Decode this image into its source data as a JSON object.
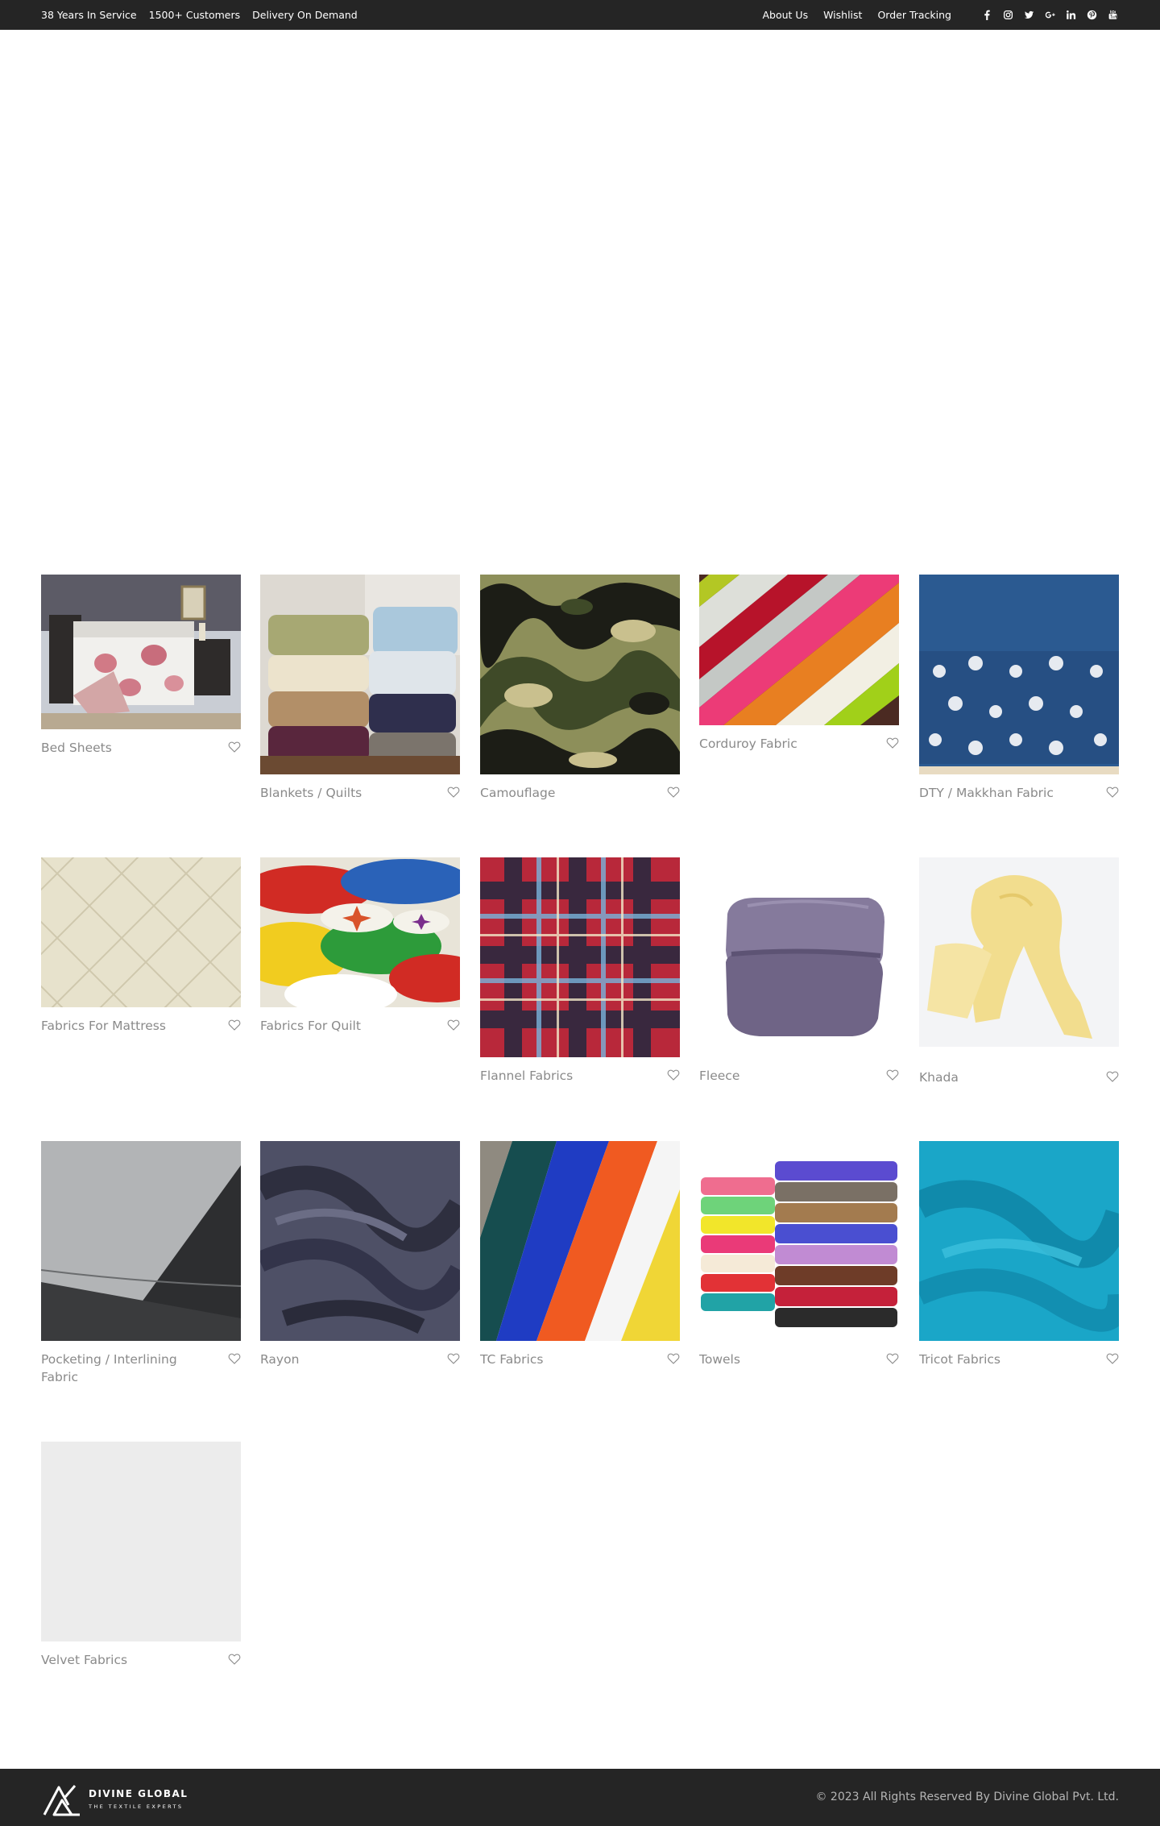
{
  "topbar": {
    "left_items": [
      "38 Years In Service",
      "1500+ Customers",
      "Delivery On Demand"
    ],
    "links": [
      "About Us",
      "Wishlist",
      "Order Tracking"
    ],
    "social_icons": [
      "facebook-icon",
      "instagram-icon",
      "twitter-icon",
      "google-plus-icon",
      "linkedin-icon",
      "pinterest-icon",
      "youtube-icon"
    ]
  },
  "products": [
    {
      "name": "Bed Sheets",
      "image": "bedroom-sheet-image"
    },
    {
      "name": "Blankets / Quilts",
      "image": "folded-blankets-image"
    },
    {
      "name": "Camouflage",
      "image": "camouflage-image"
    },
    {
      "name": "Corduroy Fabric",
      "image": "corduroy-image"
    },
    {
      "name": "DTY / Makkhan Fabric",
      "image": "embroidered-denim-image"
    },
    {
      "name": "Fabrics For Mattress",
      "image": "quilted-mattress-image"
    },
    {
      "name": "Fabrics For Quilt",
      "image": "patchwork-quilt-image"
    },
    {
      "name": "Flannel Fabrics",
      "image": "plaid-flannel-image"
    },
    {
      "name": "Fleece",
      "image": "folded-fleece-image"
    },
    {
      "name": "Khada",
      "image": "yellow-scarf-image"
    },
    {
      "name": "Pocketing / Interlining Fabric",
      "image": "interlining-image"
    },
    {
      "name": "Rayon",
      "image": "rayon-image"
    },
    {
      "name": "TC Fabrics",
      "image": "colored-fabric-rolls-image"
    },
    {
      "name": "Towels",
      "image": "towel-stacks-image"
    },
    {
      "name": "Tricot Fabrics",
      "image": "teal-tricot-image"
    },
    {
      "name": "Velvet Fabrics",
      "image": "placeholder-image"
    }
  ],
  "colors": {
    "topbar_bg": "#252525",
    "caption": "#8a8a8a",
    "footer_bg": "#252525"
  },
  "footer": {
    "brand": "DIVINE GLOBAL",
    "tagline": "THE TEXTILE EXPERTS",
    "copyright": "© 2023 All Rights Reserved By Divine Global Pvt. Ltd."
  }
}
